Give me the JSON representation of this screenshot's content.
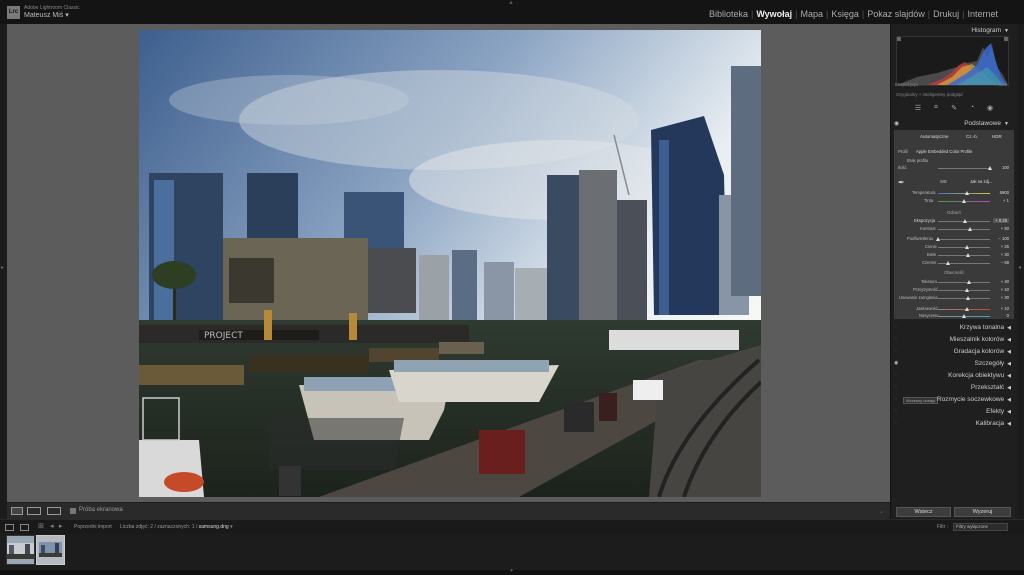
{
  "app": {
    "name": "Adobe Lightroom Classic",
    "user": "Mateusz Miś",
    "user_chevron": "▾"
  },
  "modules": [
    "Biblioteka",
    "Wywołaj",
    "Mapa",
    "Księga",
    "Pokaz slajdów",
    "Drukuj",
    "Internet"
  ],
  "active_module": "Wywołaj",
  "toolbar": {
    "proof_label": "Próba ekranowa"
  },
  "histogram": {
    "title": "Histogram",
    "left_label": "Ekspozycja",
    "right_label": "+ 0,25",
    "original_label": "Oryginalny + inteligentny podgląd"
  },
  "basic": {
    "title": "Podstawowe",
    "btn_auto": "Automatyczne",
    "btn_bw": "Cz.-b.",
    "btn_hdr": "HDR",
    "profile_label": "Profil",
    "profile_value": "Apple Embedded Color Profile",
    "no_profile": "Brak profilu",
    "amount_label": "Ilość",
    "amount_value": "100",
    "wb_label": "WB",
    "wb_value": "Jak na zdj...",
    "temp_label": "Temperatura",
    "temp_value": "5900",
    "tint_label": "Tinta",
    "tint_value": "+ 1",
    "tone_header": "Odcień",
    "exposure_label": "Ekspozycja",
    "exposure_value": "+ 0,25",
    "contrast_label": "Kontrast",
    "contrast_value": "+ 50",
    "highlights_label": "Podświetlenia",
    "highlights_value": "− 100",
    "shadows_label": "Cienie",
    "shadows_value": "+ 25",
    "whites_label": "Biele",
    "whites_value": "+ 30",
    "blacks_label": "Czernie",
    "blacks_value": "− 59",
    "presence_header": "Obecność",
    "texture_label": "Tekstura",
    "texture_value": "+ 40",
    "clarity_label": "Przejrzystość",
    "clarity_value": "+ 10",
    "dehaze_label": "Usuwanie zamglenia",
    "dehaze_value": "+ 30",
    "vibrance_label": "Jaskrawość",
    "vibrance_value": "+ 10",
    "saturation_label": "Nasycenie",
    "saturation_value": "0"
  },
  "slider_levels": {
    "amount": 1.0,
    "temp": 0.55,
    "tint": 0.5,
    "exposure": 0.52,
    "contrast": 0.62,
    "highlights": 0.0,
    "shadows": 0.56,
    "whites": 0.58,
    "blacks": 0.2,
    "texture": 0.6,
    "clarity": 0.55,
    "dehaze": 0.58,
    "vibrance": 0.55,
    "saturation": 0.5
  },
  "sections": [
    "Krzywa tonalna",
    "Mieszalnik kolorów",
    "Gradacja kolorów",
    "Szczegóły",
    "Korekcja obiektywu",
    "Przekształć",
    "Rozmycie soczewkowe",
    "Efekty",
    "Kalibracja"
  ],
  "lens_blur_badge": "Wczesny dostęp",
  "panel_buttons": {
    "previous": "Wstecz",
    "reset": "Wyzeruj"
  },
  "filmstrip": {
    "source": "Poprzedni import",
    "count": "Liczba zdjęć: 2 / zaznaczonych: 1 /",
    "file": "samsung.dng",
    "file_chevron": "▾",
    "filter_label": "Filtr :",
    "filter_value": "Filtry wyłączone"
  },
  "colors": {
    "accent_panel": "#3a3a3a",
    "viewer_bg": "#5c5c5c",
    "background": "#111111"
  }
}
